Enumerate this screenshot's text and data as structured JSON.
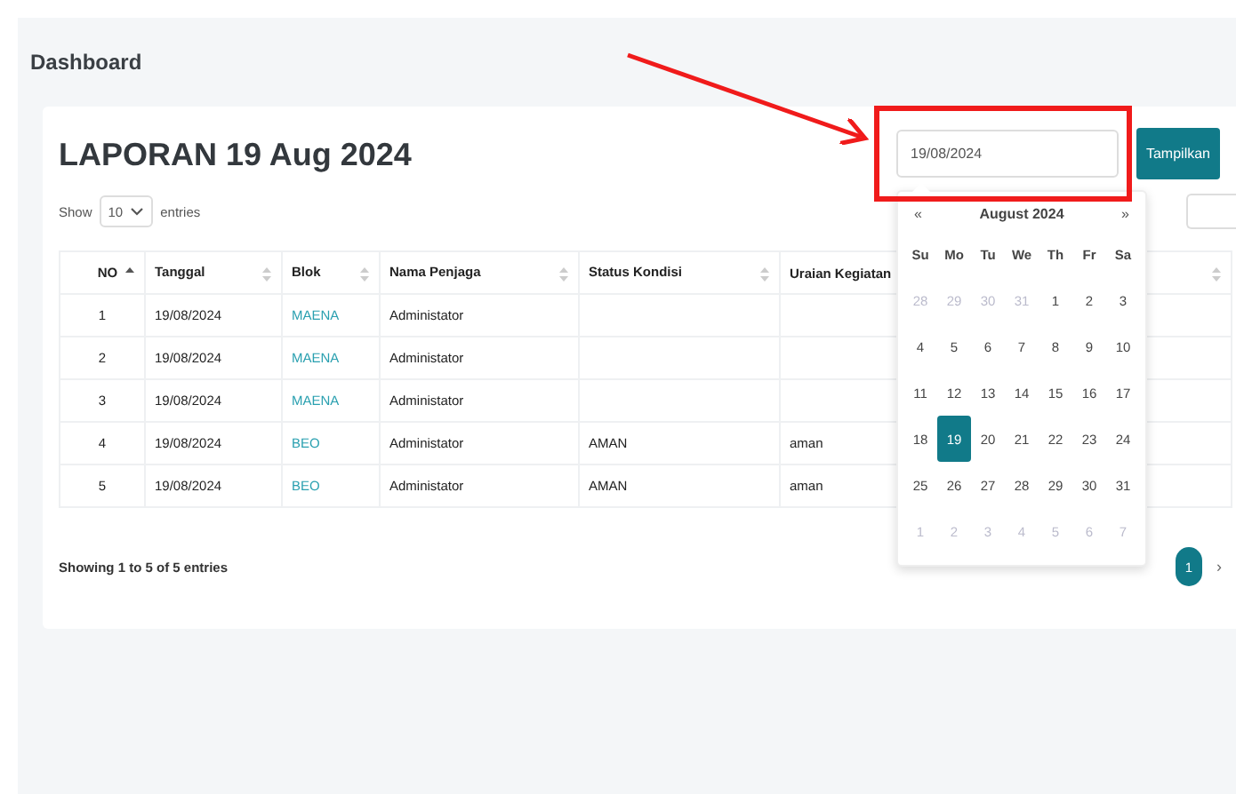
{
  "page_title": "Dashboard",
  "report": {
    "title": "LAPORAN 19 Aug 2024",
    "date_field": {
      "value": "19/08/2024"
    },
    "submit_button": "Tampilkan",
    "length_menu": {
      "before": "Show",
      "value": "10",
      "after": "entries"
    },
    "table": {
      "columns": [
        {
          "label": "NO",
          "sorted": true,
          "kind": "number"
        },
        {
          "label": "Tanggal",
          "sorted": false,
          "kind": "text"
        },
        {
          "label": "Blok",
          "sorted": false,
          "kind": "link"
        },
        {
          "label": "Nama Penjaga",
          "sorted": false,
          "kind": "text"
        },
        {
          "label": "Status Kondisi",
          "sorted": false,
          "kind": "text"
        },
        {
          "label": "Uraian Kegiatan",
          "kind": "text"
        }
      ],
      "rows": [
        [
          "1",
          "19/08/2024",
          "MAENA",
          "Administator"
        ],
        [
          "2",
          "19/08/2024",
          "MAENA",
          "Administator"
        ],
        [
          "3",
          "19/08/2024",
          "MAENA",
          "Administator"
        ],
        [
          "4",
          "19/08/2024",
          "BEO",
          "Administator",
          "AMAN",
          "aman"
        ],
        [
          "5",
          "19/08/2024",
          "BEO",
          "Administator",
          "AMAN",
          "aman"
        ]
      ]
    },
    "info": "Showing 1 to 5 of 5 entries",
    "pagination": {
      "pages": [
        {
          "label": "1",
          "selected": true
        }
      ],
      "next": "›"
    }
  },
  "datepicker": {
    "prev": "«",
    "title": "August 2024",
    "next": "»",
    "weekdays": [
      "Su",
      "Mo",
      "Tu",
      "We",
      "Th",
      "Fr",
      "Sa"
    ],
    "days": [
      {
        "day": "28",
        "outside": true,
        "selected": false
      },
      {
        "day": "29",
        "outside": true,
        "selected": false
      },
      {
        "day": "30",
        "outside": true,
        "selected": false
      },
      {
        "day": "31",
        "outside": true,
        "selected": false
      },
      {
        "day": "1",
        "outside": false,
        "selected": false
      },
      {
        "day": "2",
        "outside": false,
        "selected": false
      },
      {
        "day": "3",
        "outside": false,
        "selected": false
      },
      {
        "day": "4",
        "outside": false,
        "selected": false
      },
      {
        "day": "5",
        "outside": false,
        "selected": false
      },
      {
        "day": "6",
        "outside": false,
        "selected": false
      },
      {
        "day": "7",
        "outside": false,
        "selected": false
      },
      {
        "day": "8",
        "outside": false,
        "selected": false
      },
      {
        "day": "9",
        "outside": false,
        "selected": false
      },
      {
        "day": "10",
        "outside": false,
        "selected": false
      },
      {
        "day": "11",
        "outside": false,
        "selected": false
      },
      {
        "day": "12",
        "outside": false,
        "selected": false
      },
      {
        "day": "13",
        "outside": false,
        "selected": false
      },
      {
        "day": "14",
        "outside": false,
        "selected": false
      },
      {
        "day": "15",
        "outside": false,
        "selected": false
      },
      {
        "day": "16",
        "outside": false,
        "selected": false
      },
      {
        "day": "17",
        "outside": false,
        "selected": false
      },
      {
        "day": "18",
        "outside": false,
        "selected": false
      },
      {
        "day": "19",
        "outside": false,
        "selected": true
      },
      {
        "day": "20",
        "outside": false,
        "selected": false
      },
      {
        "day": "21",
        "outside": false,
        "selected": false
      },
      {
        "day": "22",
        "outside": false,
        "selected": false
      },
      {
        "day": "23",
        "outside": false,
        "selected": false
      },
      {
        "day": "24",
        "outside": false,
        "selected": false
      },
      {
        "day": "25",
        "outside": false,
        "selected": false
      },
      {
        "day": "26",
        "outside": false,
        "selected": false
      },
      {
        "day": "27",
        "outside": false,
        "selected": false
      },
      {
        "day": "28",
        "outside": false,
        "selected": false
      },
      {
        "day": "29",
        "outside": false,
        "selected": false
      },
      {
        "day": "30",
        "outside": false,
        "selected": false
      },
      {
        "day": "31",
        "outside": false,
        "selected": false
      },
      {
        "day": "1",
        "outside": true,
        "selected": false
      },
      {
        "day": "2",
        "outside": true,
        "selected": false
      },
      {
        "day": "3",
        "outside": true,
        "selected": false
      },
      {
        "day": "4",
        "outside": true,
        "selected": false
      },
      {
        "day": "5",
        "outside": true,
        "selected": false
      },
      {
        "day": "6",
        "outside": true,
        "selected": false
      },
      {
        "day": "7",
        "outside": true,
        "selected": false
      }
    ]
  }
}
